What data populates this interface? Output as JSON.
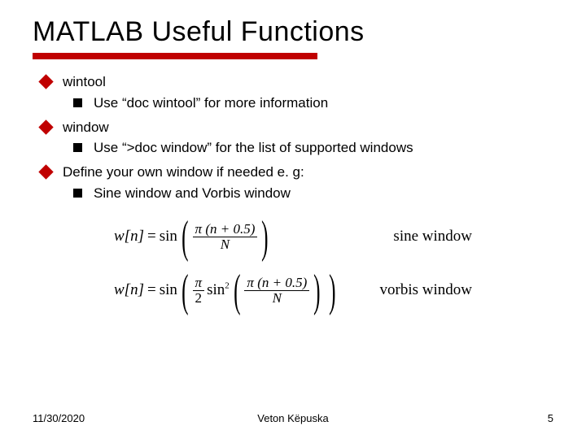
{
  "title": "MATLAB Useful Functions",
  "bullets": {
    "b1": "wintool",
    "b1a": "Use “doc wintool” for more information",
    "b2": "window",
    "b2a": "Use “>doc window” for the list of supported windows",
    "b3": "Define your own window if needed e. g:",
    "b3a": "Sine window and Vorbis window"
  },
  "formulas": {
    "wn": "w[n]",
    "eq": "=",
    "sin": "sin",
    "pi": "π",
    "numer": "(n + 0.5)",
    "N": "N",
    "two": "2",
    "label1": "sine window",
    "label2": "vorbis window"
  },
  "footer": {
    "date": "11/30/2020",
    "author": "Veton Këpuska",
    "page": "5"
  }
}
